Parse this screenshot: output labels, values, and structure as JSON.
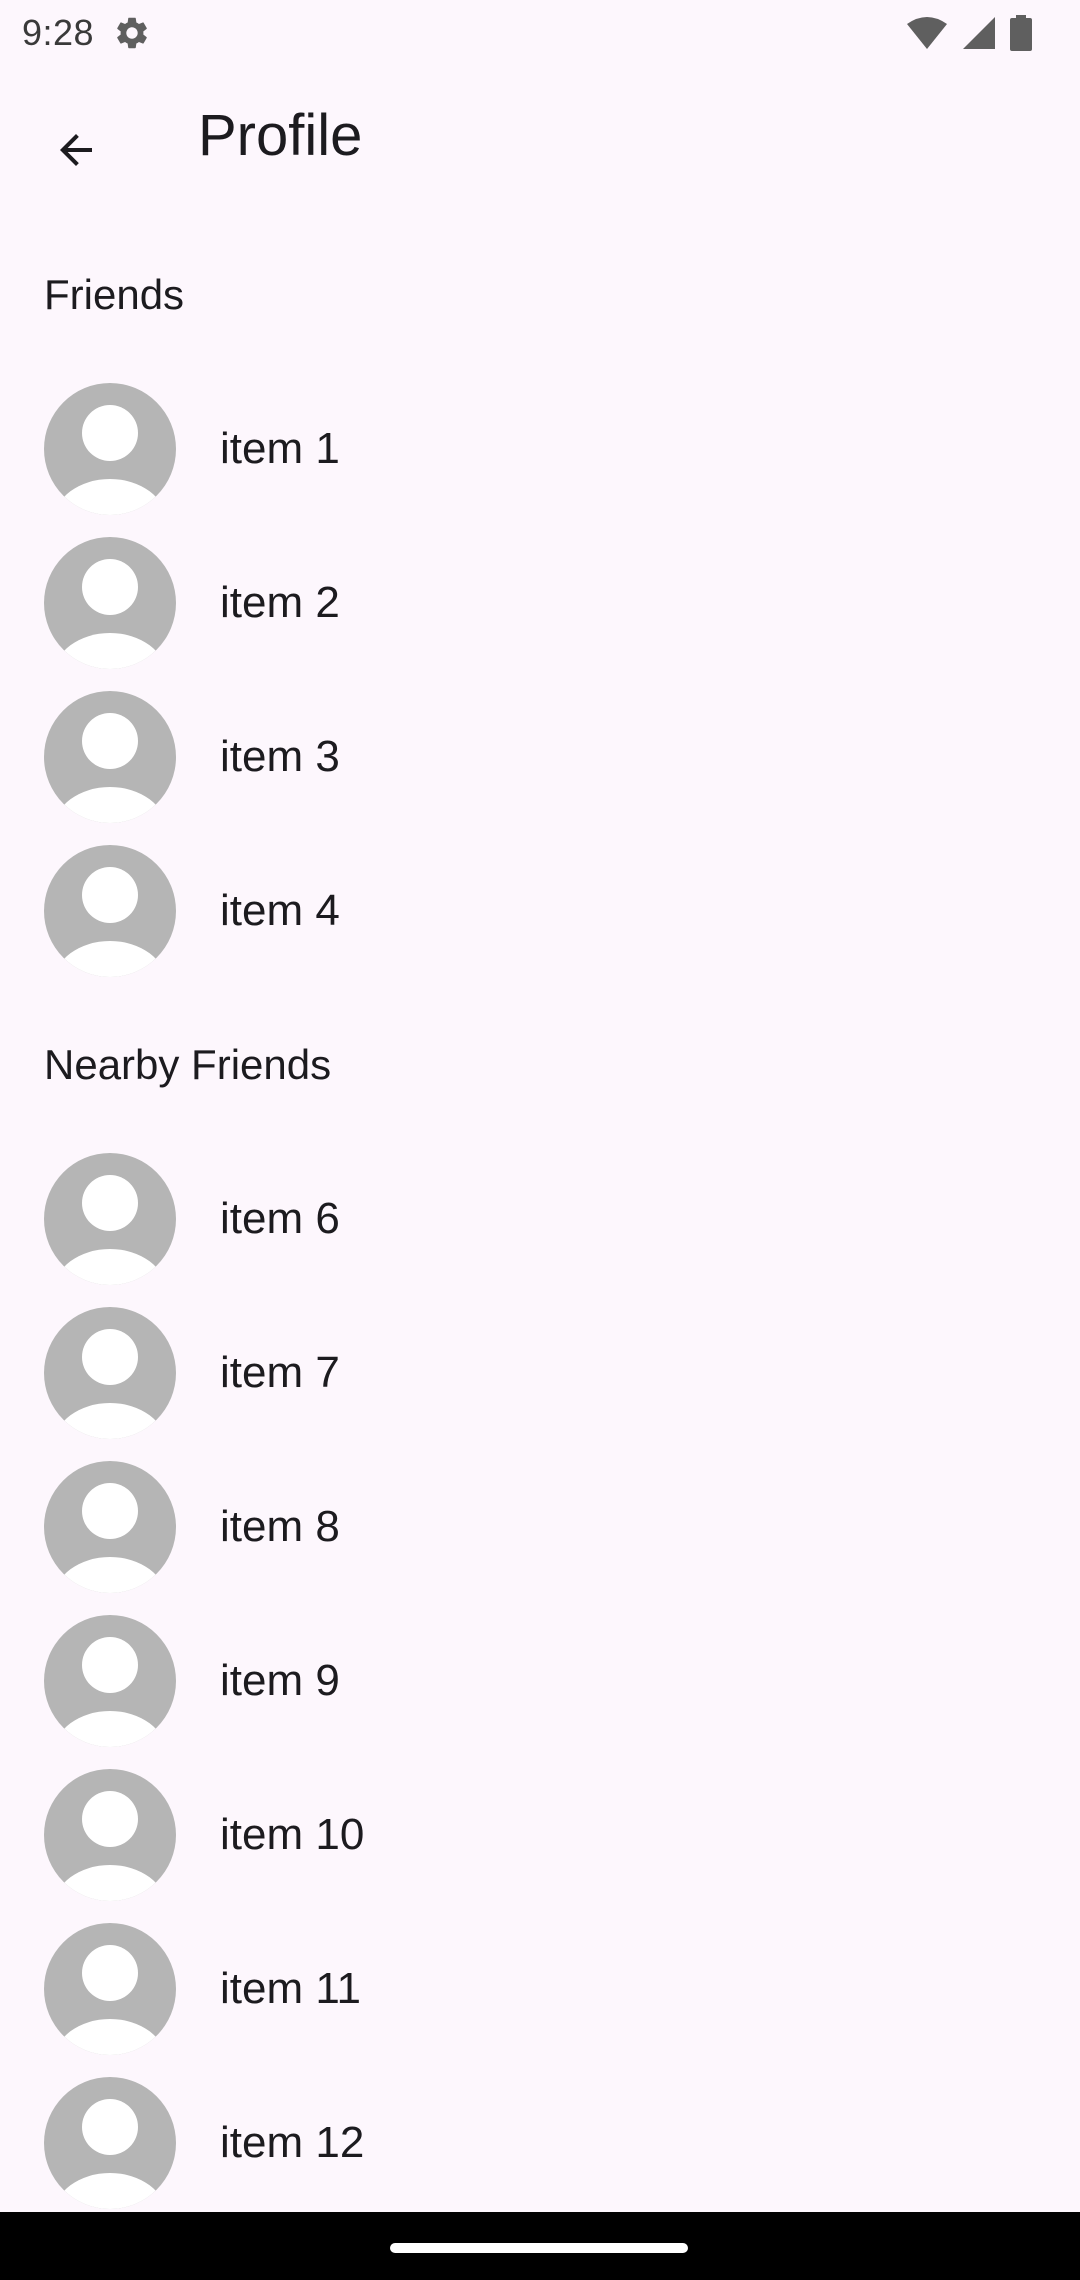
{
  "status_bar": {
    "time": "9:28",
    "icons": [
      "settings-icon",
      "wifi-icon",
      "cellular-signal-icon",
      "battery-icon"
    ]
  },
  "app_bar": {
    "back_icon": "arrow-back-icon",
    "title": "Profile"
  },
  "sections": [
    {
      "title": "Friends",
      "items": [
        {
          "label": "item 1"
        },
        {
          "label": "item 2"
        },
        {
          "label": "item 3"
        },
        {
          "label": "item 4"
        }
      ]
    },
    {
      "title": "Nearby Friends",
      "items": [
        {
          "label": "item 6"
        },
        {
          "label": "item 7"
        },
        {
          "label": "item 8"
        },
        {
          "label": "item 9"
        },
        {
          "label": "item 10"
        },
        {
          "label": "item 11"
        },
        {
          "label": "item 12"
        }
      ]
    }
  ],
  "colors": {
    "background": "#fdf7fd",
    "avatar_gray": "#b5b5b5",
    "text": "#1c1b1f",
    "nav_bar": "#000000"
  }
}
